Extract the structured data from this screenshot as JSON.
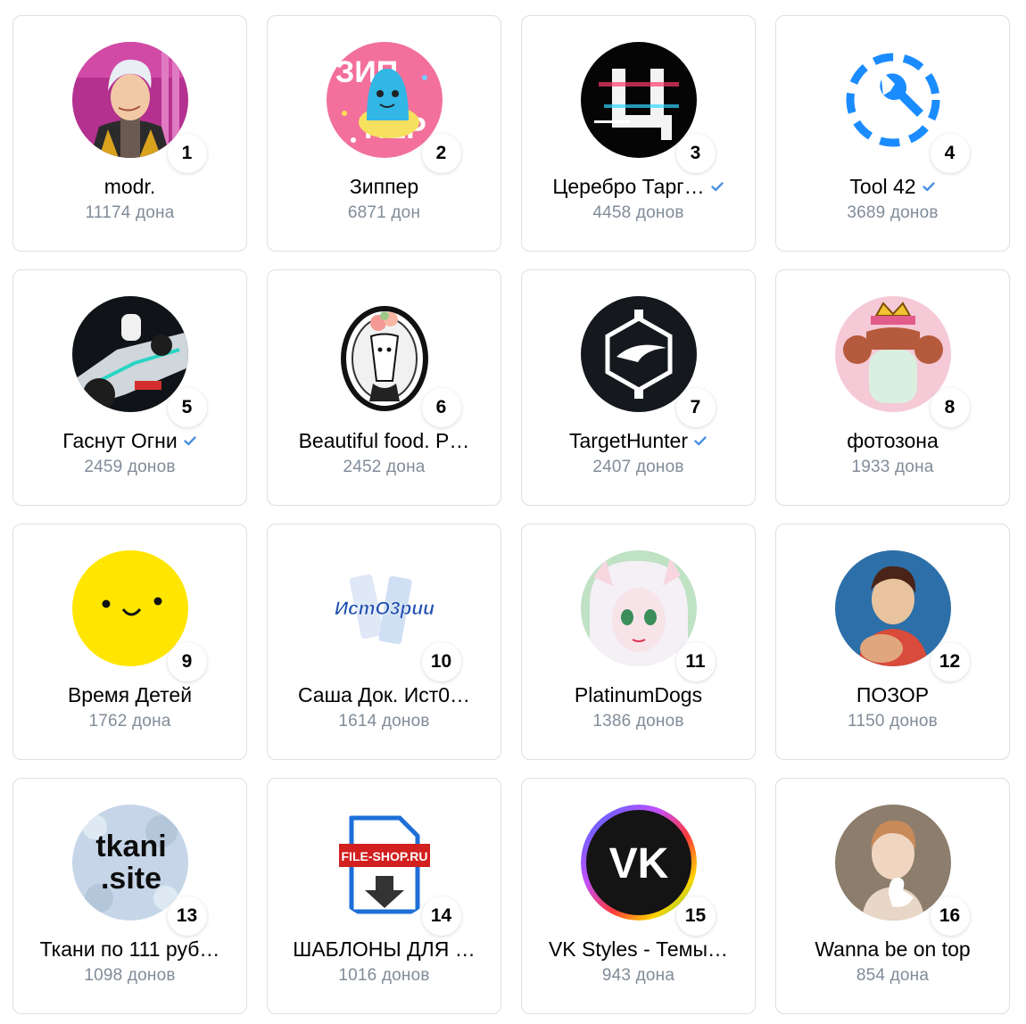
{
  "colors": {
    "verified": "#4a90e2",
    "muted_text": "#818c99",
    "card_border": "#dcdfe3"
  },
  "cards": [
    {
      "rank": "1",
      "name": "modr.",
      "count": "11174 дона",
      "verified": false,
      "avatar_icon": "cartoon-man-avatar-icon"
    },
    {
      "rank": "2",
      "name": "Зиппер",
      "count": "6871 дон",
      "verified": false,
      "avatar_icon": "zipper-blob-avatar-icon"
    },
    {
      "rank": "3",
      "name": "Церебро Тарг…",
      "count": "4458 донов",
      "verified": true,
      "avatar_icon": "glitch-letter-avatar-icon"
    },
    {
      "rank": "4",
      "name": "Tool 42",
      "count": "3689 донов",
      "verified": true,
      "avatar_icon": "wrench-circle-avatar-icon"
    },
    {
      "rank": "5",
      "name": "Гаснут Огни",
      "count": "2459 донов",
      "verified": true,
      "avatar_icon": "race-car-avatar-icon"
    },
    {
      "rank": "6",
      "name": "Beautiful food. P…",
      "count": "2452 дона",
      "verified": false,
      "avatar_icon": "deer-portrait-avatar-icon"
    },
    {
      "rank": "7",
      "name": "TargetHunter",
      "count": "2407 донов",
      "verified": true,
      "avatar_icon": "target-hunter-logo-icon"
    },
    {
      "rank": "8",
      "name": "фотозона",
      "count": "1933 дона",
      "verified": false,
      "avatar_icon": "crown-princess-avatar-icon"
    },
    {
      "rank": "9",
      "name": "Время Детей",
      "count": "1762 дона",
      "verified": false,
      "avatar_icon": "smiley-face-avatar-icon"
    },
    {
      "rank": "10",
      "name": "Саша Док. Ист0…",
      "count": "1614 донов",
      "verified": false,
      "avatar_icon": "ist0rii-logo-icon",
      "avatar_text": "ИстО3рии"
    },
    {
      "rank": "11",
      "name": "PlatinumDogs",
      "count": "1386 донов",
      "verified": false,
      "avatar_icon": "anime-girl-avatar-icon"
    },
    {
      "rank": "12",
      "name": "ПОЗОР",
      "count": "1150 донов",
      "verified": false,
      "avatar_icon": "boy-with-dog-avatar-icon"
    },
    {
      "rank": "13",
      "name": "Ткани по 111 руб…",
      "count": "1098 донов",
      "verified": false,
      "avatar_icon": "tkani-site-logo-icon",
      "avatar_text": "tkani",
      "avatar_text2": ".site"
    },
    {
      "rank": "14",
      "name": "ШАБЛОНЫ ДЛЯ …",
      "count": "1016 донов",
      "verified": false,
      "avatar_icon": "file-shop-logo-icon",
      "avatar_text": "FILE-SHOP.RU"
    },
    {
      "rank": "15",
      "name": "VK Styles - Темы…",
      "count": "943 дона",
      "verified": false,
      "avatar_icon": "vk-logo-icon",
      "avatar_text": "VK"
    },
    {
      "rank": "16",
      "name": "Wanna be on top",
      "count": "854 дона",
      "verified": false,
      "avatar_icon": "woman-with-swan-avatar-icon"
    }
  ]
}
